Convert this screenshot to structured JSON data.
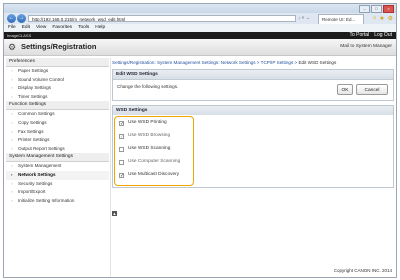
{
  "browser": {
    "url": "http://192.168.0.215/m_network_wsd_edit.html",
    "url_tools": "↓ × →",
    "tab_title": "Remote UI: Ed..."
  },
  "menu": [
    "File",
    "Edit",
    "View",
    "Favorites",
    "Tools",
    "Help"
  ],
  "top_bar": {
    "device": "ImageCLASS",
    "portal_link": "To Portal",
    "logout_link": "Log Out"
  },
  "header": {
    "title": "Settings/Registration",
    "mail": "Mail to System Manager"
  },
  "sidebar": [
    {
      "type": "heading",
      "label": "Preferences"
    },
    {
      "type": "item",
      "label": "Paper Settings"
    },
    {
      "type": "item",
      "label": "Sound Volume Control"
    },
    {
      "type": "item",
      "label": "Display Settings"
    },
    {
      "type": "item",
      "label": "Timer Settings"
    },
    {
      "type": "heading",
      "label": "Function Settings"
    },
    {
      "type": "item",
      "label": "Common Settings"
    },
    {
      "type": "item",
      "label": "Copy Settings"
    },
    {
      "type": "item",
      "label": "Fax Settings"
    },
    {
      "type": "item",
      "label": "Printer Settings"
    },
    {
      "type": "item",
      "label": "Output Report Settings"
    },
    {
      "type": "heading",
      "label": "System Management Settings"
    },
    {
      "type": "item",
      "label": "System Management"
    },
    {
      "type": "item",
      "label": "Network Settings",
      "active": true
    },
    {
      "type": "item",
      "label": "Security Settings"
    },
    {
      "type": "item",
      "label": "Import/Export"
    },
    {
      "type": "item",
      "label": "Initialize Setting Information"
    }
  ],
  "breadcrumb": {
    "links": "Settings/Registration: System Management Settings: Network Settings > TCP/IP Settings >",
    "current": "Edit WSD Settings"
  },
  "edit_panel": {
    "title": "Edit WSD Settings",
    "message": "Change the following settings.",
    "ok": "OK",
    "cancel": "Cancel"
  },
  "wsd": {
    "title": "WSD Settings",
    "options": [
      {
        "label": "Use WSD Printing",
        "checked": true,
        "enabled": true
      },
      {
        "label": "Use WSD Browsing",
        "checked": true,
        "enabled": false
      },
      {
        "label": "Use WSD Scanning",
        "checked": false,
        "enabled": true
      },
      {
        "label": "Use Computer Scanning",
        "checked": false,
        "enabled": false
      },
      {
        "label": "Use Multicast Discovery",
        "checked": true,
        "enabled": true
      }
    ]
  },
  "footer": {
    "copyright": "Copyright CANON INC. 2014"
  }
}
